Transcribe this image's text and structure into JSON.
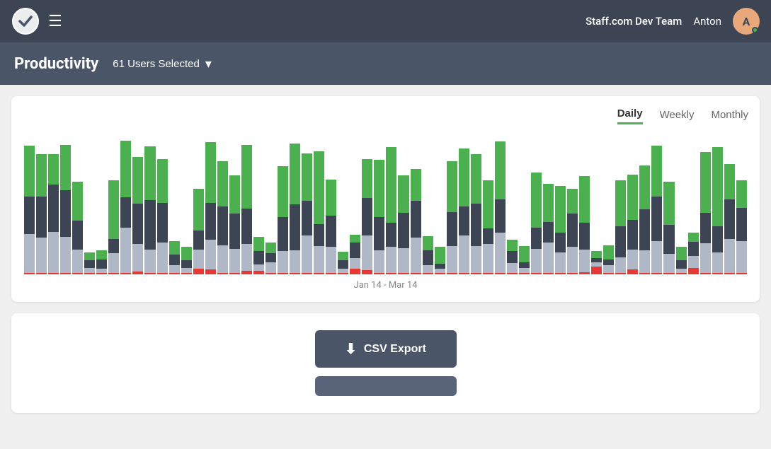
{
  "navbar": {
    "logo_alt": "Staff.com logo",
    "hamburger_label": "☰",
    "team_name": "Staff.com Dev Team",
    "username": "Anton",
    "avatar_initial": "A",
    "avatar_bg": "#e8a87c"
  },
  "page_header": {
    "title": "Productivity",
    "users_selected": "61 Users Selected",
    "chevron": "▾"
  },
  "chart_card": {
    "period_tabs": [
      {
        "label": "Daily",
        "active": true
      },
      {
        "label": "Weekly",
        "active": false
      },
      {
        "label": "Monthly",
        "active": false
      }
    ],
    "date_range": "Jan 14 - Mar 14",
    "colors": {
      "green": "#4caf50",
      "dark": "#3d4554",
      "gray": "#b0b8c8",
      "red": "#e53935"
    }
  },
  "export_card": {
    "csv_export_label": "CSV Export",
    "csv_icon": "⬇",
    "second_button_label": ""
  }
}
